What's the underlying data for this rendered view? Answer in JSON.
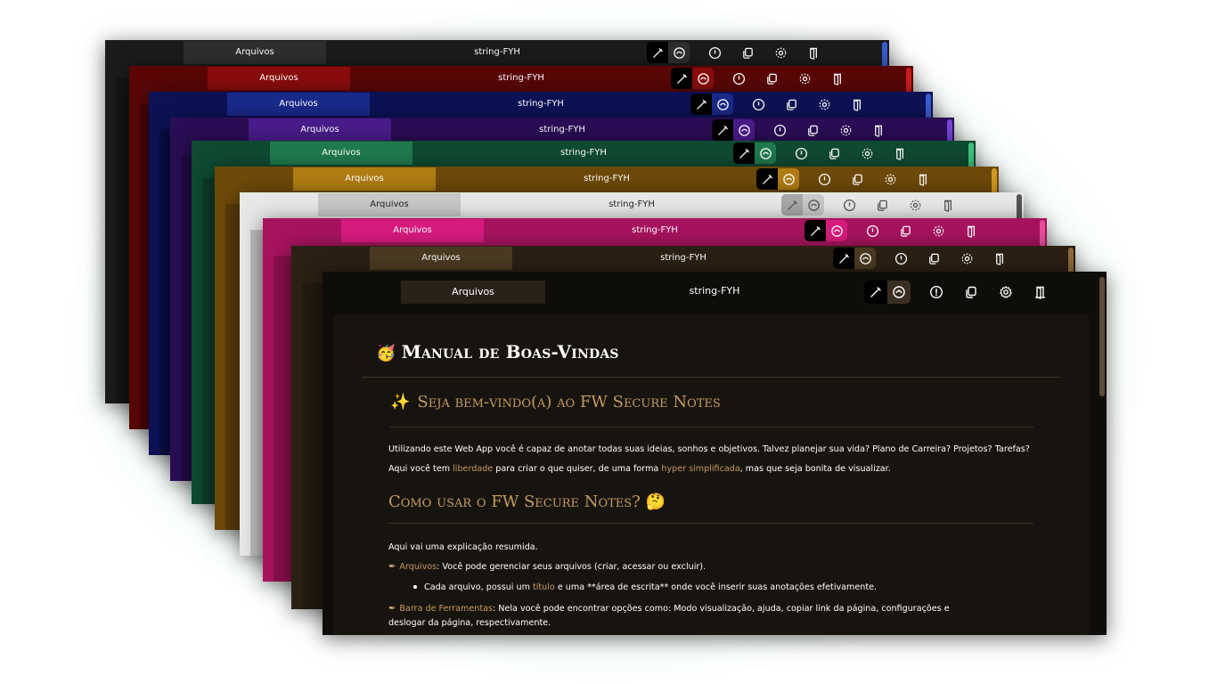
{
  "app": {
    "tab_label": "Arquivos",
    "title": "string-FYH"
  },
  "toolbar": {
    "icons": [
      "edit-mode-icon",
      "view-mode-icon",
      "help-icon",
      "copy-link-icon",
      "settings-icon",
      "logout-icon"
    ]
  },
  "themes": [
    {
      "name": "dark",
      "bg": "#1b1b1b",
      "tab": "#2e2e2e",
      "text": "#ffffff",
      "scroll": "#3b5bd0"
    },
    {
      "name": "red",
      "bg": "#5a0606",
      "tab": "#8a0c0c",
      "text": "#ffffff",
      "scroll": "#d01c1c"
    },
    {
      "name": "blue",
      "bg": "#0d1257",
      "tab": "#1a2a8a",
      "text": "#ffffff",
      "scroll": "#3b5bd0"
    },
    {
      "name": "purple",
      "bg": "#2a0d55",
      "tab": "#4a1c8a",
      "text": "#ffffff",
      "scroll": "#7a46d8"
    },
    {
      "name": "green",
      "bg": "#0f4a32",
      "tab": "#1f7a4e",
      "text": "#ffffff",
      "scroll": "#3fc07a"
    },
    {
      "name": "amber",
      "bg": "#6e4a0a",
      "tab": "#b07d12",
      "text": "#ffffff",
      "scroll": "#d49a22"
    },
    {
      "name": "light",
      "bg": "#e8e8e8",
      "tab": "#c8c8c8",
      "text": "#222222",
      "scroll": "#555555"
    },
    {
      "name": "pink",
      "bg": "#a8135e",
      "tab": "#d81b7e",
      "text": "#ffffff",
      "scroll": "#e8509a"
    },
    {
      "name": "brown",
      "bg": "#2b2014",
      "tab": "#4a3a22",
      "text": "#ffffff",
      "scroll": "#8a6a3a"
    }
  ],
  "front_theme": {
    "name": "espresso",
    "bg": "#0f0d0a",
    "page": "#171410",
    "accent": "#c49a5e"
  },
  "doc": {
    "title": "Manual de Boas-Vindas",
    "title_emoji": "🥳",
    "section1": {
      "emoji": "✨",
      "heading": "Seja bem-vindo(a) ao FW Secure Notes"
    },
    "intro_line1": "Utilizando este Web App você é capaz de anotar todas suas ideias, sonhos e objetivos. Talvez planejar sua vida? Plano de Carreira? Projetos? Tarefas?",
    "intro_line2": {
      "p1": "Aqui você tem ",
      "link1": "liberdade",
      "p2": " para criar o que quiser, de uma forma ",
      "link2": "hyper simplificada",
      "p3": ", mas que seja bonita de visualizar."
    },
    "section2": {
      "heading": "Como usar o FW Secure Notes?",
      "emoji": "🤔"
    },
    "summary": "Aqui vai uma explicação resumida.",
    "item1": {
      "label": "Arquivos",
      "text": ": Você pode gerenciar seus arquivos (criar, acessar ou excluir)."
    },
    "item1_sub": {
      "p1": "Cada arquivo, possui um ",
      "link": "título",
      "p2": " e uma **área de escrita** onde você inserir suas anotações efetivamente."
    },
    "item2": {
      "label": "Barra de Ferramentas",
      "text": ": Nela você pode encontrar opções como: Modo visualização, ajuda, copiar link da página, configurações e",
      "text2": "deslogar da página, respectivamente."
    },
    "bullet_icon": "feather-icon"
  }
}
